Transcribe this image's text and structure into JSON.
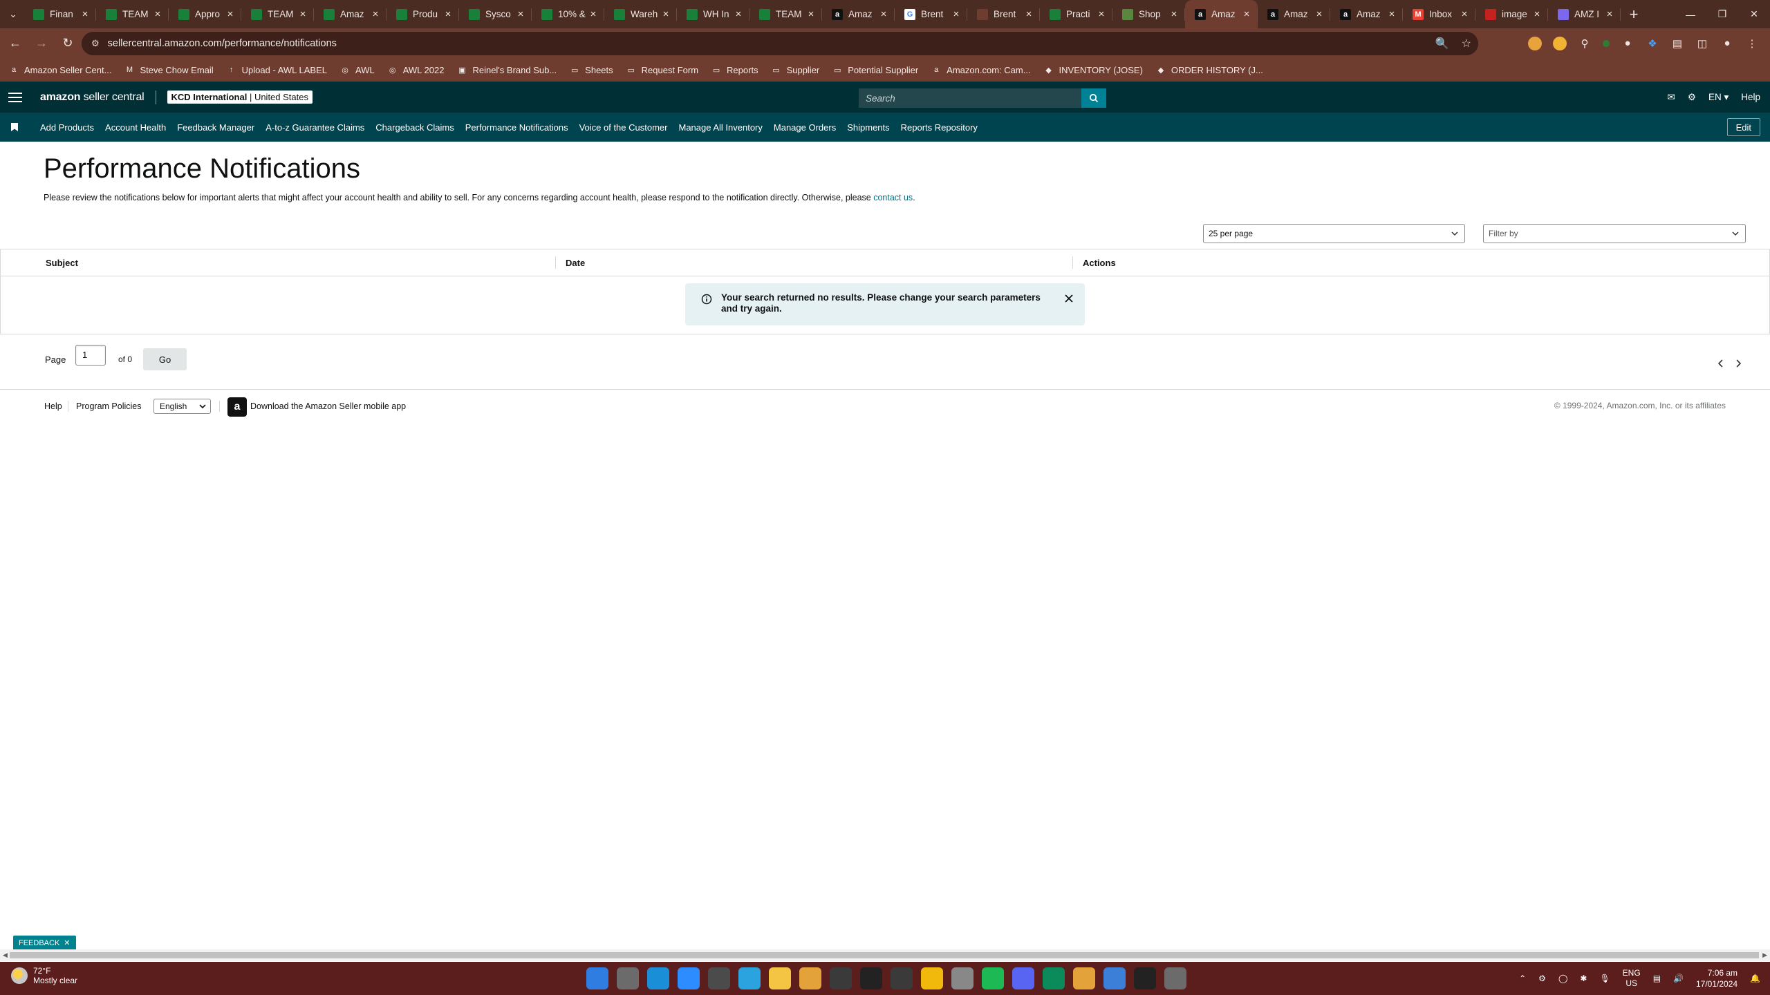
{
  "browser": {
    "tabs": [
      {
        "title": "Finan",
        "icon": "sheets",
        "color": "#188038"
      },
      {
        "title": "TEAM",
        "icon": "sheets",
        "color": "#188038"
      },
      {
        "title": "Appro",
        "icon": "sheets",
        "color": "#188038"
      },
      {
        "title": "TEAM",
        "icon": "sheets",
        "color": "#188038"
      },
      {
        "title": "Amaz",
        "icon": "sheets",
        "color": "#188038"
      },
      {
        "title": "Produ",
        "icon": "sheets",
        "color": "#188038"
      },
      {
        "title": "Sysco",
        "icon": "sheets",
        "color": "#188038"
      },
      {
        "title": "10% &",
        "icon": "sheets",
        "color": "#188038"
      },
      {
        "title": "Wareh",
        "icon": "sheets",
        "color": "#188038"
      },
      {
        "title": "WH In",
        "icon": "sheets",
        "color": "#188038"
      },
      {
        "title": "TEAM",
        "icon": "sheets",
        "color": "#188038"
      },
      {
        "title": "Amaz",
        "icon": "amazon",
        "color": "#111111"
      },
      {
        "title": "Brent",
        "icon": "google",
        "color": "#ffffff"
      },
      {
        "title": "Brent",
        "icon": "globe",
        "color": "#6e3d2f"
      },
      {
        "title": "Practi",
        "icon": "sheets",
        "color": "#188038"
      },
      {
        "title": "Shop",
        "icon": "shopify",
        "color": "#5a863e"
      },
      {
        "title": "Amaz",
        "icon": "amazon",
        "color": "#111111",
        "active": true
      },
      {
        "title": "Amaz",
        "icon": "amazon",
        "color": "#111111"
      },
      {
        "title": "Amaz",
        "icon": "amazon",
        "color": "#111111"
      },
      {
        "title": "Inbox",
        "icon": "gmail",
        "color": "#ea4335"
      },
      {
        "title": "image",
        "icon": "image",
        "color": "#c5221f"
      },
      {
        "title": "AMZ I",
        "icon": "clickup",
        "color": "#7b68ee"
      }
    ],
    "url": "sellercentral.amazon.com/performance/notifications",
    "bookmarks": [
      {
        "label": "Amazon Seller Cent...",
        "icon": "amazon"
      },
      {
        "label": "Steve Chow Email",
        "icon": "gmail"
      },
      {
        "label": "Upload - AWL LABEL",
        "icon": "upload"
      },
      {
        "label": "AWL",
        "icon": "globe"
      },
      {
        "label": "AWL 2022",
        "icon": "globe"
      },
      {
        "label": "Reinel's Brand Sub...",
        "icon": "doc"
      },
      {
        "label": "Sheets",
        "icon": "folder"
      },
      {
        "label": "Request Form",
        "icon": "folder"
      },
      {
        "label": "Reports",
        "icon": "folder"
      },
      {
        "label": "Supplier",
        "icon": "folder"
      },
      {
        "label": "Potential Supplier",
        "icon": "folder"
      },
      {
        "label": "Amazon.com: Cam...",
        "icon": "amazon"
      },
      {
        "label": "INVENTORY (JOSE)",
        "icon": "clickup"
      },
      {
        "label": "ORDER HISTORY (J...",
        "icon": "clickup"
      }
    ]
  },
  "header": {
    "logo_brand": "amazon",
    "logo_product": "seller central",
    "account_name": "KCD International",
    "account_market": "United States",
    "search_placeholder": "Search",
    "language": "EN",
    "help": "Help"
  },
  "nav": {
    "items": [
      "Add Products",
      "Account Health",
      "Feedback Manager",
      "A-to-z Guarantee Claims",
      "Chargeback Claims",
      "Performance Notifications",
      "Voice of the Customer",
      "Manage All Inventory",
      "Manage Orders",
      "Shipments",
      "Reports Repository"
    ],
    "edit": "Edit"
  },
  "page": {
    "title": "Performance Notifications",
    "intro": "Please review the notifications below for important alerts that might affect your account health and ability to sell. For any concerns regarding account health, please respond to the notification directly. Otherwise, please ",
    "contact_link": "contact us",
    "intro_end": ".",
    "per_page": "25 per page",
    "filter_by": "Filter by",
    "columns": [
      "Subject",
      "Date",
      "Actions"
    ],
    "alert": "Your search returned no results. Please change your search parameters and try again.",
    "pager": {
      "page_label": "Page",
      "page_value": "1",
      "of_label": "of 0",
      "go": "Go"
    }
  },
  "footer": {
    "help": "Help",
    "policies": "Program Policies",
    "language": "English",
    "app": "Download the Amazon Seller mobile app",
    "copyright": "© 1999-2024, Amazon.com, Inc. or its affiliates",
    "feedback": "FEEDBACK"
  },
  "taskbar": {
    "temperature": "72°F",
    "weather": "Mostly clear",
    "lang1": "ENG",
    "lang2": "US",
    "time": "7:06 am",
    "date": "17/01/2024",
    "apps": [
      {
        "name": "start-icon",
        "color": "#2f7de1"
      },
      {
        "name": "taskview-icon",
        "color": "#6b6b6b"
      },
      {
        "name": "edge-icon",
        "color": "#1a8fd8"
      },
      {
        "name": "zoom-icon",
        "color": "#2d8cff"
      },
      {
        "name": "calculator-icon",
        "color": "#4b4b4b"
      },
      {
        "name": "telegram-icon",
        "color": "#2aa3de"
      },
      {
        "name": "file-explorer-icon",
        "color": "#f4c542"
      },
      {
        "name": "chrome-icon",
        "color": "#e4a23a"
      },
      {
        "name": "steam-icon",
        "color": "#3a3a3a"
      },
      {
        "name": "g-hub-icon",
        "color": "#222222"
      },
      {
        "name": "fan-icon",
        "color": "#3a3a3a"
      },
      {
        "name": "binance-icon",
        "color": "#f0b90b"
      },
      {
        "name": "vpn-icon",
        "color": "#888888"
      },
      {
        "name": "spotify-icon",
        "color": "#1db954"
      },
      {
        "name": "discord-icon",
        "color": "#5865f2"
      },
      {
        "name": "app-icon",
        "color": "#0b8a5a"
      },
      {
        "name": "chrome-profile-icon",
        "color": "#e4a23a"
      },
      {
        "name": "notepad-icon",
        "color": "#3b7fd9"
      },
      {
        "name": "g-app-icon",
        "color": "#222222"
      },
      {
        "name": "settings-icon",
        "color": "#6b6b6b"
      }
    ]
  }
}
